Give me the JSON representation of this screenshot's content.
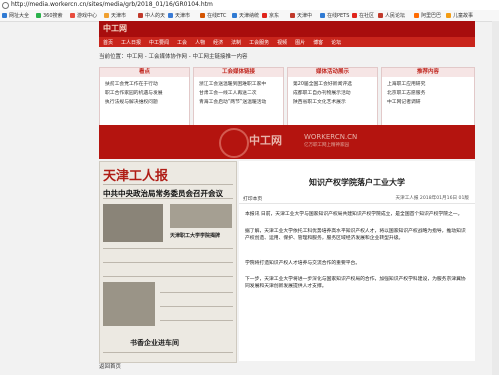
{
  "browser": {
    "url": "http://media.workercn.cn/sites/media/grb/2018_01/16/GR0104.htm",
    "bookmarks": [
      {
        "label": "网址大全",
        "color": "#2f7ad3"
      },
      {
        "label": "360搜索",
        "color": "#2bb24c"
      },
      {
        "label": "游戏中心",
        "color": "#e84c3d"
      },
      {
        "label": "天津市",
        "color": "#f0a030"
      },
      {
        "label": "中人的天",
        "color": "#c0392b"
      },
      {
        "label": "天津市",
        "color": "#3a7bd5"
      },
      {
        "label": "在线ETC",
        "color": "#d35400"
      },
      {
        "label": "天津纳统",
        "color": "#2f7ad3"
      },
      {
        "label": "京东",
        "color": "#e0241b"
      },
      {
        "label": "天津中",
        "color": "#c0392b"
      },
      {
        "label": "在线PETS",
        "color": "#2f7ad3"
      },
      {
        "label": "在社区",
        "color": "#e0241b"
      },
      {
        "label": "人民论坛",
        "color": "#c0392b"
      },
      {
        "label": "阿里巴巴",
        "color": "#ff6a00"
      },
      {
        "label": "儿童故事",
        "color": "#f39c12"
      }
    ]
  },
  "site": {
    "logo": "中工网",
    "nav": [
      "首页",
      "工人日报",
      "中工要闻",
      "工会",
      "人物",
      "经济",
      "法制",
      "工会服务",
      "视频",
      "图片",
      "博客",
      "论坛"
    ],
    "breadcrumb": "当前位置：中工网 - 工会媒体协作网 - 中工网主链接推一内容"
  },
  "boxes": [
    {
      "title": "看点",
      "items": [
        "扶贫工会党工作在于行动",
        "职工合作家园的机遇与发展",
        "执行法规与解决维权问题"
      ]
    },
    {
      "title": "工会媒体链接",
      "items": [
        "浙江工会送温暖到困难职工家中",
        "甘肃工会一线工人再送二次",
        "青海工会启动“两节”送温暖活动"
      ]
    },
    {
      "title": "媒体活动展示",
      "items": [
        "第20届全国工会好新闻评选",
        "成都职工自办刊物展示活动",
        "陕西省职工文化艺术展示"
      ]
    },
    {
      "title": "推荐内容",
      "items": [
        "上海职工应用研究",
        "北京职工志愿服务",
        "中工网记者调研"
      ]
    }
  ],
  "banner": {
    "logo": "中工网",
    "domain": "WORKERCN.CN",
    "slogan": "亿万职工网上精神家园"
  },
  "newspaper": {
    "masthead": "天津工人报",
    "headline": "中共中央政治局常务委员会召开会议",
    "subhead": "天津职工大学学院揭牌",
    "lower": "书香企业进车间"
  },
  "article": {
    "title": "知识产权学院落户工业大学",
    "print_label": "打印本页",
    "source": "天津工人报  2018年01月16日 01版",
    "paragraphs": [
      "本报讯 日前，天津工业大学与国家知识产权局共建知识产权学院成立，是全国首个知识产权学院之一。",
      "据了解，天津工业大学依托工科优势培养高水平知识产权人才，将以国家知识产权战略为指导，推动知识产权创造、运用、保护、管理和服务，服务区域经济发展和企业转型升级。",
      "学院将打造知识产权人才培养与交流合作的重要平台。",
      "下一步，天津工业大学将进一步深化与国家知识产权局的合作，加强知识产权学科建设，为服务京津冀协同发展和天津创新发展提供人才支撑。"
    ]
  },
  "footer": {
    "label": "返回首页"
  }
}
